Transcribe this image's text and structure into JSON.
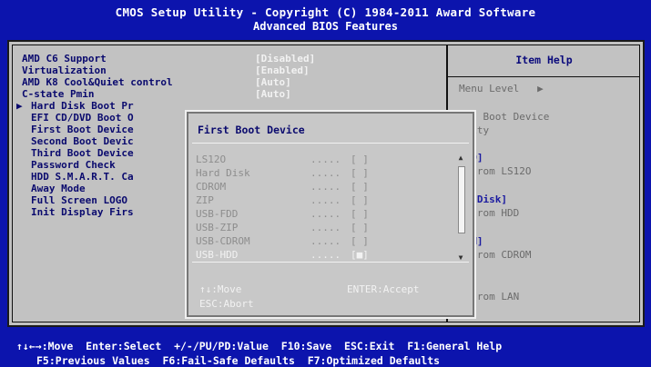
{
  "header": {
    "line1": "CMOS Setup Utility - Copyright (C) 1984-2011 Award Software",
    "line2": "Advanced BIOS Features"
  },
  "settings": [
    {
      "label": "AMD C6 Support",
      "value": "[Disabled]"
    },
    {
      "label": "Virtualization",
      "value": "[Enabled]"
    },
    {
      "label": "AMD K8 Cool&Quiet control",
      "value": "[Auto]"
    },
    {
      "label": "C-state Pmin",
      "value": "[Auto]"
    },
    {
      "label": "Hard Disk Boot Pr",
      "value": ""
    },
    {
      "label": "EFI CD/DVD Boot O",
      "value": ""
    },
    {
      "label": "First Boot Device",
      "value": ""
    },
    {
      "label": "Second Boot Devic",
      "value": ""
    },
    {
      "label": "Third Boot Device",
      "value": ""
    },
    {
      "label": "Password Check",
      "value": ""
    },
    {
      "label": "HDD S.M.A.R.T. Ca",
      "value": ""
    },
    {
      "label": "Away Mode",
      "value": ""
    },
    {
      "label": "Full Screen LOGO",
      "value": ""
    },
    {
      "label": "Init Display Firs",
      "value": ""
    }
  ],
  "cursor_arrow": "▶",
  "help": {
    "title": "Item Help",
    "menu_level": "Menu Level   ▶",
    "lines": [
      {
        "text": "ect Boot Device",
        "style": "gray"
      },
      {
        "text": "ority",
        "style": "gray"
      },
      {
        "text": "12O]",
        "style": "blue"
      },
      {
        "text": "t from LS12O",
        "style": "gray"
      },
      {
        "text": "rd Disk]",
        "style": "blue"
      },
      {
        "text": "t from HDD",
        "style": "gray"
      },
      {
        "text": "ROM]",
        "style": "blue"
      },
      {
        "text": "t from CDROM",
        "style": "gray"
      },
      {
        "text": "N]",
        "style": "blue"
      },
      {
        "text": "t from LAN",
        "style": "gray"
      }
    ]
  },
  "popup": {
    "title": "First Boot Device",
    "options": [
      {
        "name": "LS12O",
        "dots": ".....",
        "box": "[ ]"
      },
      {
        "name": "Hard Disk",
        "dots": ".....",
        "box": "[ ]"
      },
      {
        "name": "CDROM",
        "dots": ".....",
        "box": "[ ]"
      },
      {
        "name": "ZIP",
        "dots": ".....",
        "box": "[ ]"
      },
      {
        "name": "USB-FDD",
        "dots": ".....",
        "box": "[ ]"
      },
      {
        "name": "USB-ZIP",
        "dots": ".....",
        "box": "[ ]"
      },
      {
        "name": "USB-CDROM",
        "dots": ".....",
        "box": "[ ]"
      },
      {
        "name": "USB-HDD",
        "dots": ".....",
        "box": "[■]"
      }
    ],
    "scroll_up": "▲",
    "scroll_down": "▼",
    "hint_move": "↑↓:Move",
    "hint_enter": "ENTER:Accept",
    "hint_abort": "ESC:Abort"
  },
  "footer": {
    "line1": "↑↓←→:Move  Enter:Select  +/-/PU/PD:Value  F10:Save  ESC:Exit  F1:General Help",
    "line2": "F5:Previous Values  F6:Fail-Safe Defaults  F7:Optimized Defaults"
  },
  "colors": {
    "background": "#0c14ad",
    "panel": "#c2c2c2",
    "label": "#0a0a6e",
    "value": "#f2f2f2"
  }
}
